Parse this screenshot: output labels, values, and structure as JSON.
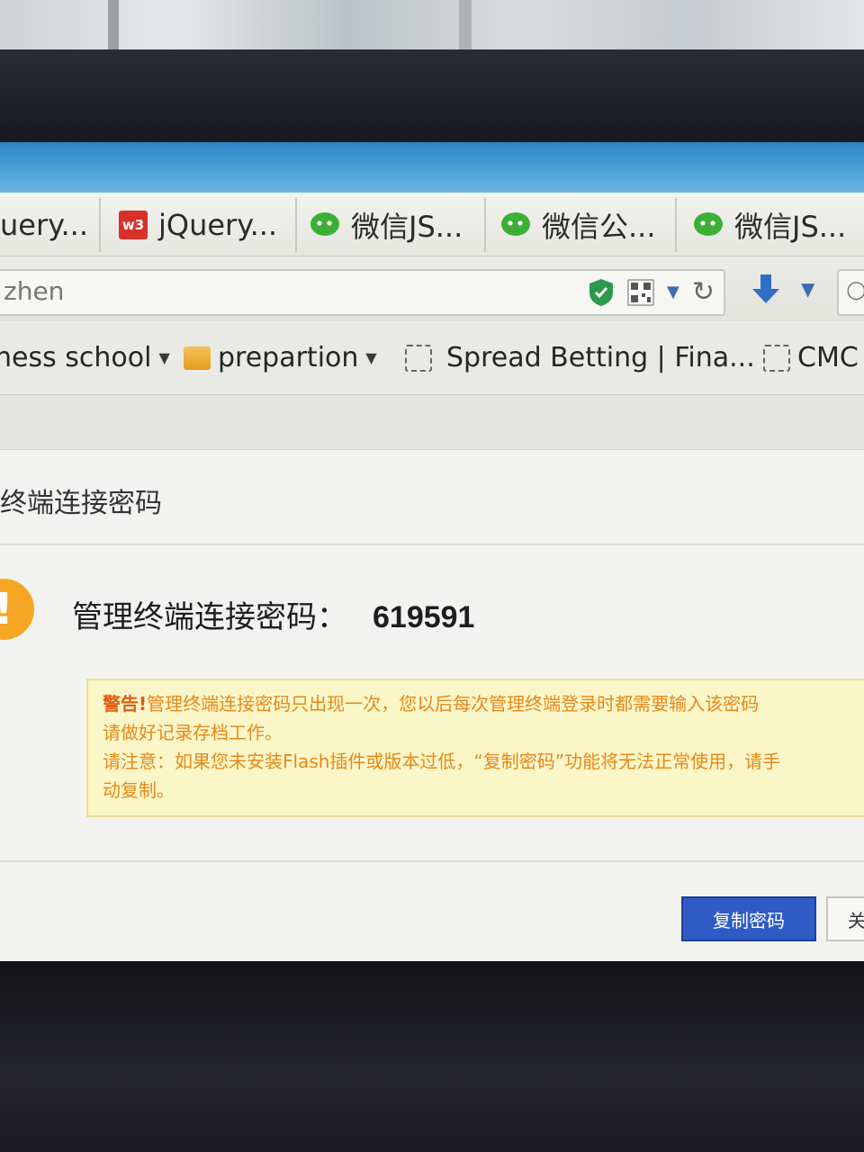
{
  "browser": {
    "tabs": [
      {
        "label": "uery...",
        "icon": "none"
      },
      {
        "label": "jQuery...",
        "icon": "w3school-icon"
      },
      {
        "label": "微信JS...",
        "icon": "wechat-icon"
      },
      {
        "label": "微信公...",
        "icon": "wechat-icon"
      },
      {
        "label": "微信JS...",
        "icon": "wechat-icon"
      }
    ],
    "w3_badge": "w3",
    "url_text": "zhen",
    "bookmarks": [
      {
        "label": "ness school"
      },
      {
        "label": "prepartion"
      },
      {
        "label": "Spread Betting | Fina..."
      },
      {
        "label": "CMC"
      }
    ]
  },
  "dialog": {
    "title": "终端连接密码",
    "warning_glyph": "!",
    "password_label": "管理终端连接密码：",
    "password_value": "619591",
    "notice": {
      "warn_prefix": "警告!",
      "line1": "管理终端连接密码只出现一次，您以后每次管理终端登录时都需要输入该密码",
      "line2": "请做好记录存档工作。",
      "line3": "请注意：如果您未安装Flash插件或版本过低，“复制密码”功能将无法正常使用，请手",
      "line4": "动复制。"
    },
    "copy_button": "复制密码",
    "close_button": "关"
  },
  "colors": {
    "accent_blue": "#2f5cc4",
    "warning_orange": "#f5a623",
    "notice_text": "#e7881a"
  }
}
